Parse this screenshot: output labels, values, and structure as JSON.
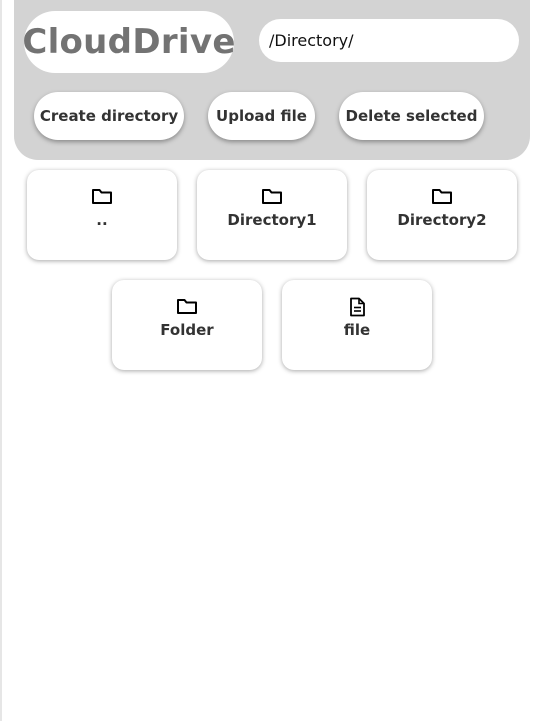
{
  "header": {
    "logo": "CloudDrive",
    "path_value": "/Directory/"
  },
  "toolbar": {
    "create_label": "Create directory",
    "upload_label": "Upload file",
    "delete_label": "Delete selected"
  },
  "items": [
    {
      "label": "..",
      "icon": "folder-icon"
    },
    {
      "label": "Directory1",
      "icon": "folder-icon"
    },
    {
      "label": "Directory2",
      "icon": "folder-icon"
    },
    {
      "label": "Folder",
      "icon": "folder-icon"
    },
    {
      "label": "file",
      "icon": "file-icon"
    }
  ],
  "colors": {
    "header_bg": "#d3d3d3",
    "logo_text": "#737373",
    "button_text": "#333333",
    "page_bg": "#ffffff"
  }
}
